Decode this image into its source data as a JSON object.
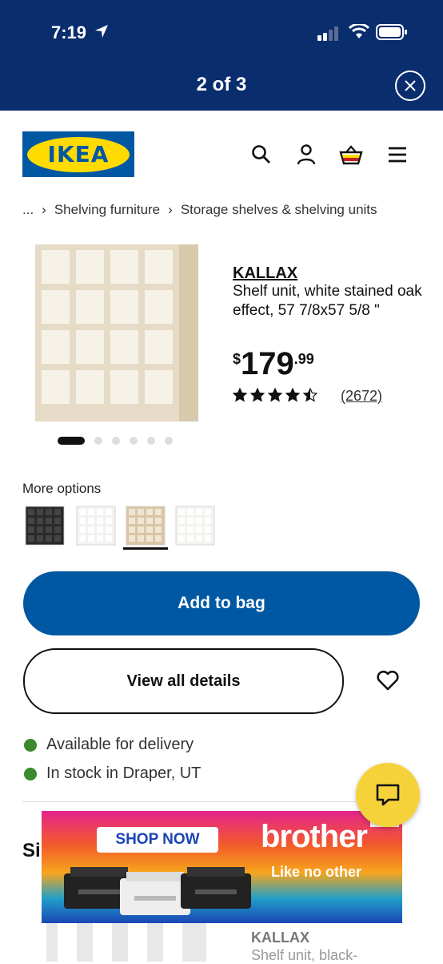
{
  "status": {
    "time": "7:19"
  },
  "viewer": {
    "counter": "2 of 3"
  },
  "header": {
    "logo_text": "IKEA"
  },
  "breadcrumb": {
    "ellipsis": "...",
    "items": [
      "Shelving furniture",
      "Storage shelves & shelving units"
    ]
  },
  "product": {
    "name": "KALLAX",
    "description": "Shelf unit, white stained oak effect, 57 7/8x57 5/8 \"",
    "price": {
      "currency": "$",
      "main": "179",
      "cents": ".99"
    },
    "rating": 4.5,
    "reviews": "(2672)",
    "image_count": 6,
    "active_image": 1
  },
  "options": {
    "label": "More options",
    "selected_index": 2,
    "colors": [
      "#2a2a2a",
      "#f2f2f0",
      "#d9c6a6",
      "#f4f3ef"
    ]
  },
  "actions": {
    "add_to_bag": "Add to bag",
    "view_details": "View all details"
  },
  "availability": [
    {
      "text": "Available for delivery"
    },
    {
      "text": "In stock in Draper, UT"
    }
  ],
  "section_partial": "Si",
  "ad": {
    "cta": "SHOP NOW",
    "brand": "brother",
    "tagline": "Like no other"
  },
  "next_product": {
    "name": "KALLAX",
    "description": "Shelf unit, black-"
  },
  "colors": {
    "nav_bar": "#0a2d6e",
    "primary": "#0058a3",
    "logo_yellow": "#ffdb00",
    "in_stock": "#3a8a2b",
    "chat": "#f5d23a"
  }
}
